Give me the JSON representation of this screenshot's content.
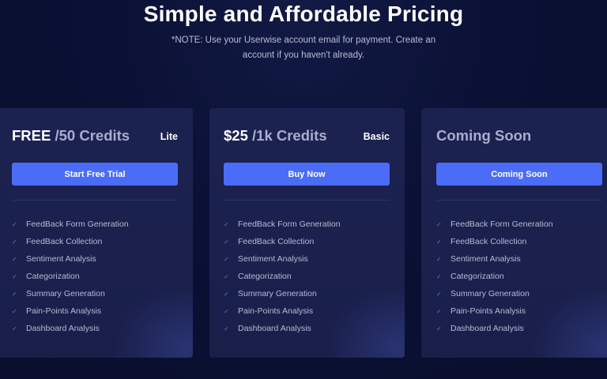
{
  "header": {
    "title": "Simple and Affordable Pricing",
    "note": "*NOTE: Use your Userwise account email for payment. Create an account if you haven't already."
  },
  "plans": [
    {
      "price": "FREE",
      "credits": "/50 Credits",
      "name": "Lite",
      "cta": "Start Free Trial",
      "features": [
        "FeedBack Form Generation",
        "FeedBack Collection",
        "Sentiment Analysis",
        "Categorization",
        "Summary Generation",
        "Pain-Points Analysis",
        "Dashboard Analysis"
      ]
    },
    {
      "price": "$25",
      "credits": "/1k Credits",
      "name": "Basic",
      "cta": "Buy Now",
      "features": [
        "FeedBack Form Generation",
        "FeedBack Collection",
        "Sentiment Analysis",
        "Categorization",
        "Summary Generation",
        "Pain-Points Analysis",
        "Dashboard Analysis"
      ]
    },
    {
      "price": "Coming Soon",
      "credits": "",
      "name": "",
      "cta": "Coming Soon",
      "features": [
        "FeedBack Form Generation",
        "FeedBack Collection",
        "Sentiment Analysis",
        "Categorization",
        "Summary Generation",
        "Pain-Points Analysis",
        "Dashboard Analysis"
      ]
    }
  ],
  "icons": {
    "feature_check": "check-icon"
  },
  "colors": {
    "background": "#0b1135",
    "card": "#1c2250",
    "accent": "#4a6cf7",
    "check": "#5b74e8"
  }
}
